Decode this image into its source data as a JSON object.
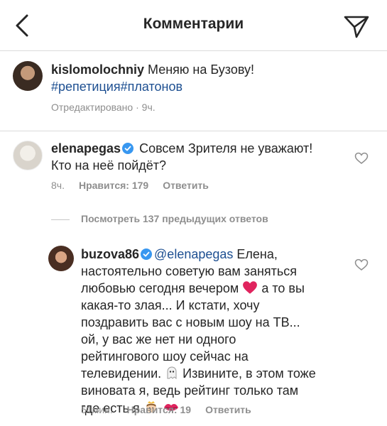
{
  "header": {
    "title": "Комментарии"
  },
  "caption": {
    "username": "kislomolochniy",
    "text": " Меняю на Бузову!",
    "hashtags": "#репетиция#платонов",
    "edited": "Отредактировано",
    "sep": " · ",
    "time": "9ч."
  },
  "comment1": {
    "username": "elenapegas",
    "text_line1": " Совсем Зрителя не уважают!",
    "text_line2": "Кто на неё пойдёт?",
    "time": "8ч.",
    "likes": "Нравится: 179",
    "reply": "Ответить"
  },
  "more_replies": "Посмотреть 137 предыдущих ответов",
  "comment2": {
    "username": "buzova86",
    "mention": "@elenapegas",
    "l1": " Елена,",
    "l2": "настоятельно советую вам заняться",
    "l3": "любовью сегодня вечером",
    "l3b": " а то вы",
    "l4": "какая-то злая... И кстати, хочу",
    "l5": "поздравить вас с новым шоу на ТВ...",
    "l6": "ой,  у вас же нет ни одного",
    "l7": "рейтингового шоу сейчас на",
    "l8": "телевидении.",
    "l8b": " Извините, в этом тоже",
    "l9": "виновата я, ведь рейтинг только там",
    "l10": "где есть я",
    "time": "51мин.",
    "likes": "Нравится: 19",
    "reply": "Ответить"
  },
  "colors": {
    "text": "#262626",
    "muted": "#8e8e8e",
    "link": "#1d4f91",
    "verified": "#3897f0",
    "heart_emoji": "#e0245e"
  },
  "icons": [
    "back-chevron-icon",
    "send-icon",
    "heart-icon",
    "verified-badge-icon",
    "ghost-emoji",
    "princess-emoji",
    "kiss-emoji",
    "red-heart-emoji"
  ]
}
